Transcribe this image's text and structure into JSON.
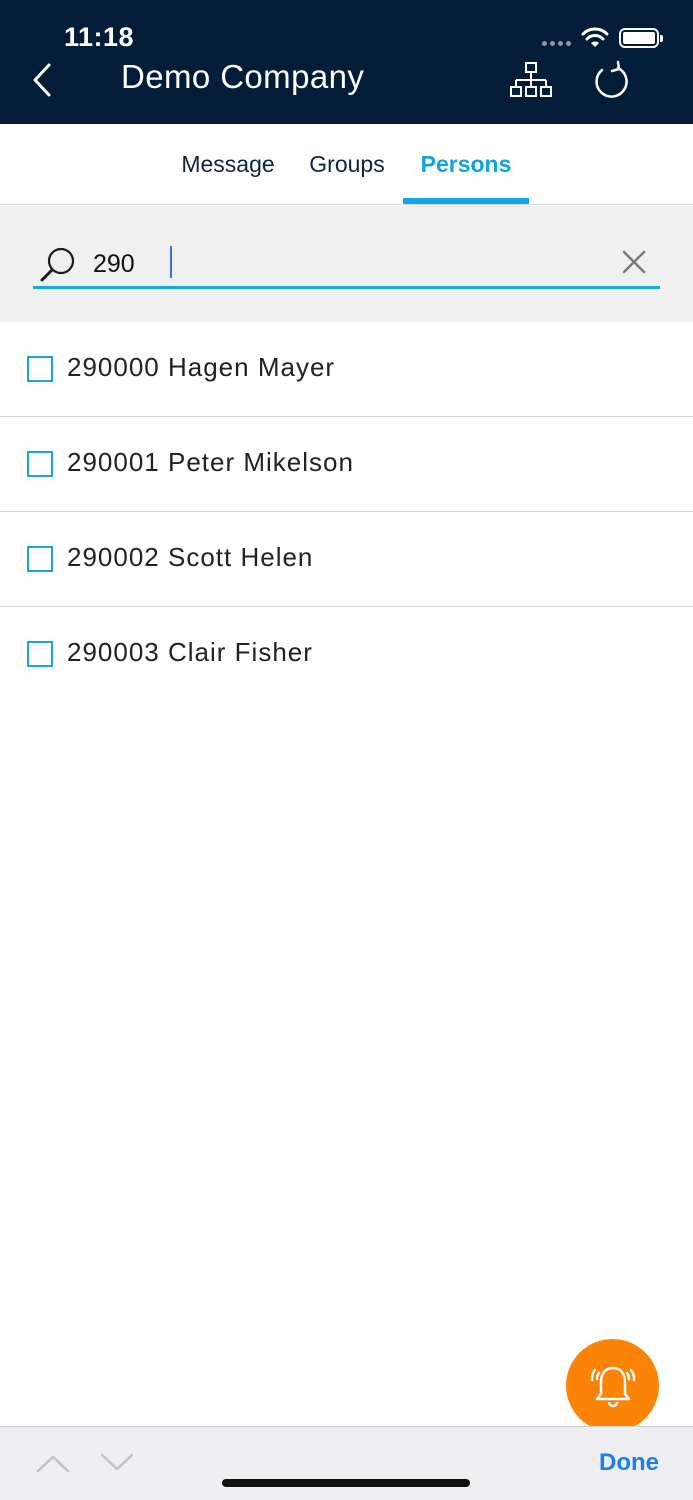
{
  "status_bar": {
    "time": "11:18"
  },
  "header": {
    "title": "Demo Company"
  },
  "tabs": [
    {
      "label": "Message",
      "active": false
    },
    {
      "label": "Groups",
      "active": false
    },
    {
      "label": "Persons",
      "active": true
    }
  ],
  "search": {
    "value": "290"
  },
  "persons": [
    {
      "label": "290000 Hagen Mayer",
      "checked": false
    },
    {
      "label": "290001 Peter Mikelson",
      "checked": false
    },
    {
      "label": "290002 Scott Helen",
      "checked": false
    },
    {
      "label": "290003 Clair Fisher",
      "checked": false
    }
  ],
  "toolbar": {
    "done_label": "Done"
  },
  "colors": {
    "header_bg": "#031d39",
    "accent": "#10a7e2",
    "fab": "#fb8407",
    "done": "#1a7ff0"
  },
  "icons": {
    "back": "chevron-left-icon",
    "org": "org-chart-icon",
    "refresh": "refresh-icon",
    "search": "search-icon",
    "clear": "close-icon",
    "alarm": "alarm-bell-icon",
    "up": "chevron-up-icon",
    "down": "chevron-down-icon"
  }
}
